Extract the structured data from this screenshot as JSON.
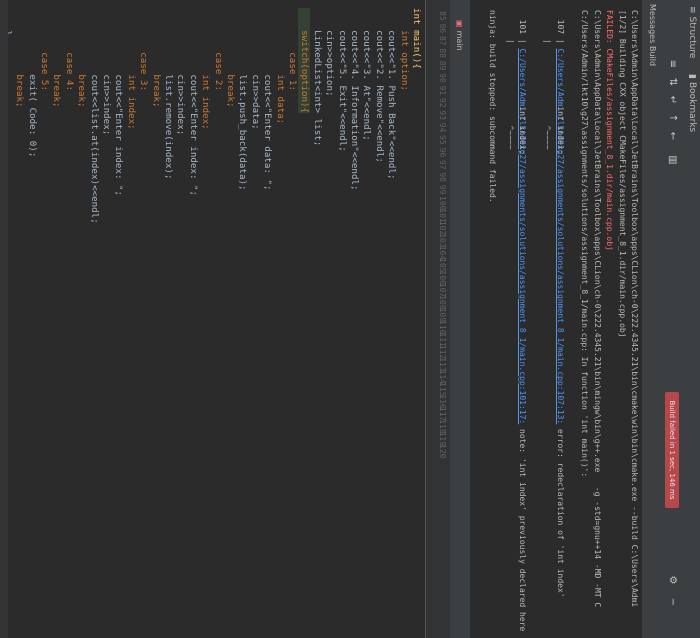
{
  "tool_windows": {
    "structure": "Structure",
    "bookmarks": "Bookmarks"
  },
  "build": {
    "tabs": {
      "messages": "Messages",
      "build": "Build"
    },
    "status": "Build failed in 1 sec, 146 ms",
    "lines": [
      "C:\\Users\\Admin\\AppData\\Local\\JetBrains\\Toolbox\\apps\\CLion\\ch-0\\222.4345.21\\bin\\cmake\\win\\bin\\cmake.exe --build C:\\Users\\Admi",
      "[1/2] Building CXX object CMakeFiles/assignment_8_1.dir/main.cpp.obj",
      "FAILED: CMakeFiles/assignment_8_1.dir/main.cpp.obj",
      "C:\\Users\\Admin\\AppData\\Local\\JetBrains\\Toolbox\\apps\\CLion\\ch-0\\222.4345.21\\bin\\mingw\\bin\\g++.exe   -g -std=gnu++14 -MD -MT C",
      "C:/Users/Admin/lkt10\\g27\\assignments/solutions/assignment_8_1/main.cpp: In function 'int main()':",
      "C:/Users/Admin/lkt101g27/assignments/solutions/assignment_8_1/main.cpp:107:13:",
      " error: redeclaration of 'int index'",
      "  107 |             int index;",
      "      |                 ^~~~~",
      "C:/Users/Admin/lkt101g27/assignments/solutions/assignment_8_1/main.cpp:101:17:",
      " note: 'int index' previously declared here",
      "  101 |             int index;",
      "      |                 ^~~~~",
      "ninja: build stopped: subcommand failed."
    ]
  },
  "project_tab": "main",
  "editor": {
    "line_numbers": [
      "85",
      "86",
      "87",
      "88",
      "89",
      "90",
      "91",
      "92",
      "93",
      "94",
      "95",
      "96",
      "97",
      "98",
      "99",
      "100",
      "101",
      "102",
      "103",
      "104",
      "105",
      "106",
      "107",
      "108",
      "109",
      "110",
      "111",
      "112",
      "113",
      "114",
      "115",
      "116",
      "117",
      "118",
      "119",
      "120"
    ],
    "code": [
      "int main(){",
      "    int option;",
      "    cout<<\"1. Push Back\"<<endl;",
      "    cout<<\"2. Remove\"<<endl;",
      "    cout<<\"3. At\"<<endl;",
      "    cout<<\"4. Information\"<<endl;",
      "    cout<<\"5. Exit\"<<endl;",
      "    cin>>option;",
      "    LinkedList<int> list;",
      "    switch(option){",
      "        case 1:",
      "            int data;",
      "            cout<<\"Enter data: \";",
      "            cin>>data;",
      "            list.push_back(data);",
      "            break;",
      "        case 2:",
      "            int index;",
      "            cout<<\"Enter index: \";",
      "            cin>>index;",
      "            list.remove(index);",
      "            break;",
      "        case 3:",
      "            int index;",
      "            cout<<\"Enter index: \";",
      "            cin>>index;",
      "            cout<<list.at(index)<<endl;",
      "            break;",
      "        case 4:",
      "            break;",
      "        case 5:",
      "            exit( Code: 0);",
      "            break;",
      "    }",
      "",
      ""
    ]
  },
  "colors": {
    "error": "#ff6b68",
    "link": "#5394ec",
    "badge": "#b6474b"
  }
}
